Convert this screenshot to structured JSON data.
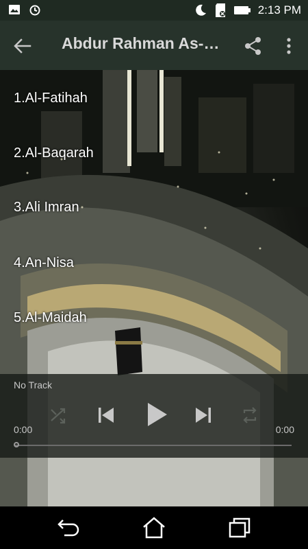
{
  "status_bar": {
    "time": "2:13 PM",
    "left_icons": [
      "image-icon",
      "sync-icon"
    ],
    "right_icons": [
      "do-not-disturb-moon-icon",
      "sd-card-icon",
      "battery-icon"
    ]
  },
  "app_bar": {
    "title": "Abdur Rahman As-…",
    "back_icon": "arrow-back-icon",
    "share_icon": "share-icon",
    "more_icon": "more-vert-icon"
  },
  "surahs": [
    {
      "label": "1.Al-Fatihah"
    },
    {
      "label": "2.Al-Baqarah"
    },
    {
      "label": "3.Ali Imran"
    },
    {
      "label": "4.An-Nisa"
    },
    {
      "label": "5.Al-Maidah"
    }
  ],
  "player": {
    "track": "No Track",
    "elapsed": "0:00",
    "duration": "0:00",
    "progress": 0,
    "controls": [
      "shuffle-icon",
      "skip-previous-icon",
      "play-icon",
      "skip-next-icon",
      "repeat-icon"
    ]
  },
  "nav_bar": {
    "buttons": [
      "back-nav-icon",
      "home-icon",
      "recents-icon"
    ]
  },
  "colors": {
    "app_bar": "#27332b",
    "status_bar": "#1f2a22",
    "player_bg": "#14181a"
  }
}
